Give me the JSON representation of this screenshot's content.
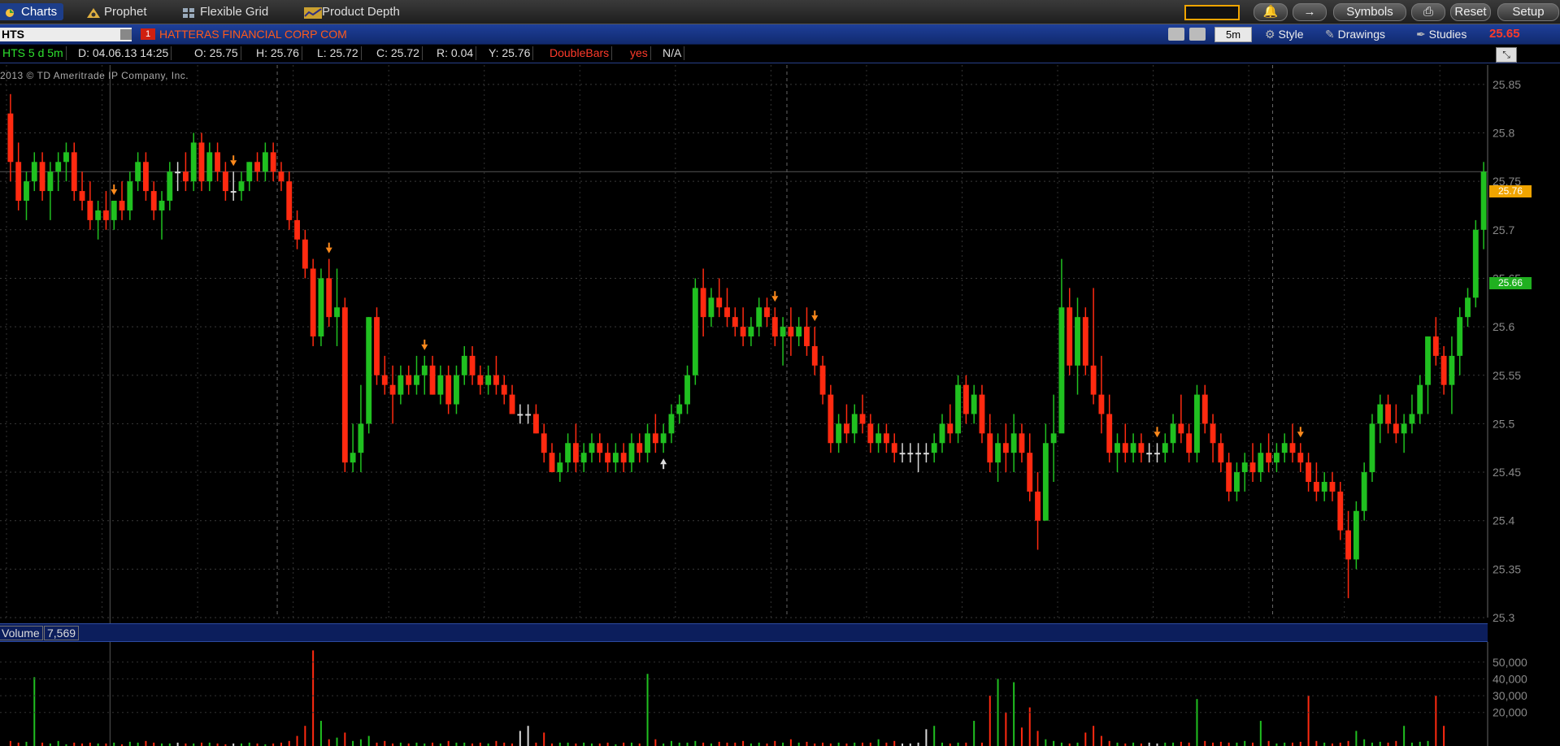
{
  "tabs": [
    {
      "label": "Charts",
      "active": true
    },
    {
      "label": "Prophet",
      "active": false
    },
    {
      "label": "Flexible Grid",
      "active": false
    },
    {
      "label": "Product Depth",
      "active": false
    }
  ],
  "right_buttons": {
    "symbols": "Symbols",
    "reset": "Reset",
    "setup": "Setup"
  },
  "symbol": "HTS",
  "company": "HATTERAS FINANCIAL CORP COM",
  "company_flag": "1",
  "toolbar": {
    "interval": "5m",
    "style": "Style",
    "drawings": "Drawings",
    "studies": "Studies",
    "last_price": "25.65"
  },
  "info": {
    "period": "HTS 5 d 5m",
    "date": "D: 04.06.13 14:25",
    "open": "O: 25.75",
    "high": "H: 25.76",
    "low": "L: 25.72",
    "close": "C: 25.72",
    "range": "R: 0.04",
    "y": "Y: 25.76",
    "doublebars": "DoubleBars",
    "yes": "yes",
    "na": "N/A"
  },
  "copyright": "2013 © TD Ameritrade IP Company, Inc.",
  "price_axis": {
    "ticks": [
      "25.85",
      "25.8",
      "25.75",
      "25.7",
      "25.65",
      "25.6",
      "25.55",
      "25.5",
      "25.45",
      "25.4",
      "25.35",
      "25.3"
    ],
    "cursor_label": "25.76",
    "last_label": "25.66"
  },
  "volume": {
    "label": "Volume",
    "value": "7,569",
    "ticks": [
      "50,000",
      "40,000",
      "30,000",
      "20,000"
    ]
  },
  "colors": {
    "up": "#20c020",
    "down": "#ff2a10",
    "neutral": "#d8d8d8",
    "arrow": "#ff8a1c",
    "tab_active": "#1d3e8a"
  },
  "icons": [
    "charts-icon",
    "prophet-icon",
    "grid-icon",
    "depth-icon",
    "bell-icon",
    "link-icon",
    "print-icon",
    "crosshair-icon",
    "wrench-icon",
    "style-icon",
    "pencil-icon",
    "studies-icon",
    "maximize-icon"
  ],
  "chart_data": {
    "type": "candlestick",
    "ylim": [
      25.3,
      25.87
    ],
    "candles": [
      [
        25.82,
        25.84,
        25.75,
        25.77
      ],
      [
        25.77,
        25.79,
        25.72,
        25.73
      ],
      [
        25.73,
        25.76,
        25.71,
        25.75
      ],
      [
        25.75,
        25.78,
        25.74,
        25.77
      ],
      [
        25.77,
        25.78,
        25.73,
        25.74
      ],
      [
        25.74,
        25.77,
        25.71,
        25.76
      ],
      [
        25.76,
        25.78,
        25.74,
        25.77
      ],
      [
        25.77,
        25.79,
        25.75,
        25.78
      ],
      [
        25.78,
        25.79,
        25.73,
        25.74
      ],
      [
        25.74,
        25.76,
        25.72,
        25.73
      ],
      [
        25.73,
        25.75,
        25.7,
        25.71
      ],
      [
        25.71,
        25.73,
        25.69,
        25.72
      ],
      [
        25.72,
        25.74,
        25.7,
        25.71
      ],
      [
        25.71,
        25.73,
        25.7,
        25.73
      ],
      [
        25.73,
        25.75,
        25.71,
        25.72
      ],
      [
        25.72,
        25.76,
        25.71,
        25.75
      ],
      [
        25.75,
        25.78,
        25.74,
        25.77
      ],
      [
        25.77,
        25.78,
        25.73,
        25.74
      ],
      [
        25.74,
        25.75,
        25.71,
        25.72
      ],
      [
        25.72,
        25.74,
        25.69,
        25.73
      ],
      [
        25.73,
        25.77,
        25.72,
        25.76
      ],
      [
        25.76,
        25.77,
        25.74,
        25.76
      ],
      [
        25.76,
        25.78,
        25.74,
        25.75
      ],
      [
        25.75,
        25.8,
        25.74,
        25.79
      ],
      [
        25.79,
        25.8,
        25.74,
        25.75
      ],
      [
        25.75,
        25.79,
        25.74,
        25.78
      ],
      [
        25.78,
        25.79,
        25.75,
        25.76
      ],
      [
        25.76,
        25.77,
        25.73,
        25.74
      ],
      [
        25.74,
        25.76,
        25.73,
        25.74
      ],
      [
        25.74,
        25.76,
        25.73,
        25.75
      ],
      [
        25.75,
        25.77,
        25.74,
        25.77
      ],
      [
        25.77,
        25.78,
        25.75,
        25.76
      ],
      [
        25.76,
        25.79,
        25.75,
        25.78
      ],
      [
        25.78,
        25.79,
        25.75,
        25.76
      ],
      [
        25.76,
        25.77,
        25.74,
        25.75
      ],
      [
        25.75,
        25.76,
        25.7,
        25.71
      ],
      [
        25.71,
        25.72,
        25.68,
        25.69
      ],
      [
        25.69,
        25.7,
        25.65,
        25.66
      ],
      [
        25.66,
        25.67,
        25.58,
        25.59
      ],
      [
        25.59,
        25.66,
        25.58,
        25.65
      ],
      [
        25.65,
        25.67,
        25.6,
        25.61
      ],
      [
        25.61,
        25.66,
        25.58,
        25.62
      ],
      [
        25.62,
        25.63,
        25.45,
        25.46
      ],
      [
        25.46,
        25.5,
        25.45,
        25.47
      ],
      [
        25.47,
        25.54,
        25.45,
        25.5
      ],
      [
        25.5,
        25.61,
        25.49,
        25.61
      ],
      [
        25.61,
        25.62,
        25.54,
        25.55
      ],
      [
        25.55,
        25.57,
        25.53,
        25.54
      ],
      [
        25.54,
        25.56,
        25.5,
        25.53
      ],
      [
        25.53,
        25.56,
        25.52,
        25.55
      ],
      [
        25.55,
        25.56,
        25.53,
        25.54
      ],
      [
        25.54,
        25.57,
        25.53,
        25.55
      ],
      [
        25.55,
        25.57,
        25.53,
        25.56
      ],
      [
        25.56,
        25.57,
        25.53,
        25.53
      ],
      [
        25.53,
        25.56,
        25.52,
        25.55
      ],
      [
        25.55,
        25.56,
        25.51,
        25.52
      ],
      [
        25.52,
        25.56,
        25.51,
        25.55
      ],
      [
        25.55,
        25.58,
        25.54,
        25.57
      ],
      [
        25.57,
        25.58,
        25.54,
        25.55
      ],
      [
        25.55,
        25.56,
        25.53,
        25.54
      ],
      [
        25.54,
        25.56,
        25.53,
        25.55
      ],
      [
        25.55,
        25.57,
        25.53,
        25.54
      ],
      [
        25.54,
        25.55,
        25.52,
        25.53
      ],
      [
        25.53,
        25.54,
        25.51,
        25.51
      ],
      [
        25.51,
        25.52,
        25.5,
        25.51
      ],
      [
        25.51,
        25.52,
        25.5,
        25.51
      ],
      [
        25.51,
        25.52,
        25.49,
        25.49
      ],
      [
        25.49,
        25.5,
        25.46,
        25.47
      ],
      [
        25.47,
        25.48,
        25.45,
        25.45
      ],
      [
        25.45,
        25.47,
        25.44,
        25.46
      ],
      [
        25.46,
        25.49,
        25.45,
        25.48
      ],
      [
        25.48,
        25.5,
        25.45,
        25.46
      ],
      [
        25.46,
        25.48,
        25.45,
        25.47
      ],
      [
        25.47,
        25.49,
        25.46,
        25.48
      ],
      [
        25.48,
        25.49,
        25.46,
        25.47
      ],
      [
        25.47,
        25.48,
        25.45,
        25.46
      ],
      [
        25.46,
        25.48,
        25.45,
        25.47
      ],
      [
        25.47,
        25.48,
        25.45,
        25.46
      ],
      [
        25.46,
        25.49,
        25.45,
        25.48
      ],
      [
        25.48,
        25.49,
        25.46,
        25.47
      ],
      [
        25.47,
        25.5,
        25.46,
        25.49
      ],
      [
        25.49,
        25.51,
        25.47,
        25.48
      ],
      [
        25.48,
        25.5,
        25.47,
        25.49
      ],
      [
        25.49,
        25.52,
        25.48,
        25.51
      ],
      [
        25.51,
        25.53,
        25.5,
        25.52
      ],
      [
        25.52,
        25.56,
        25.51,
        25.55
      ],
      [
        25.55,
        25.65,
        25.54,
        25.64
      ],
      [
        25.64,
        25.66,
        25.59,
        25.61
      ],
      [
        25.61,
        25.64,
        25.6,
        25.63
      ],
      [
        25.63,
        25.65,
        25.61,
        25.62
      ],
      [
        25.62,
        25.64,
        25.6,
        25.61
      ],
      [
        25.61,
        25.62,
        25.59,
        25.6
      ],
      [
        25.6,
        25.62,
        25.58,
        25.59
      ],
      [
        25.59,
        25.61,
        25.58,
        25.6
      ],
      [
        25.6,
        25.63,
        25.59,
        25.62
      ],
      [
        25.62,
        25.63,
        25.6,
        25.61
      ],
      [
        25.61,
        25.62,
        25.58,
        25.59
      ],
      [
        25.59,
        25.61,
        25.56,
        25.6
      ],
      [
        25.6,
        25.62,
        25.57,
        25.59
      ],
      [
        25.59,
        25.61,
        25.58,
        25.6
      ],
      [
        25.6,
        25.62,
        25.57,
        25.58
      ],
      [
        25.58,
        25.6,
        25.55,
        25.56
      ],
      [
        25.56,
        25.57,
        25.52,
        25.53
      ],
      [
        25.53,
        25.54,
        25.47,
        25.48
      ],
      [
        25.48,
        25.51,
        25.47,
        25.5
      ],
      [
        25.5,
        25.52,
        25.48,
        25.49
      ],
      [
        25.49,
        25.52,
        25.48,
        25.51
      ],
      [
        25.51,
        25.53,
        25.49,
        25.5
      ],
      [
        25.5,
        25.51,
        25.47,
        25.48
      ],
      [
        25.48,
        25.5,
        25.47,
        25.49
      ],
      [
        25.49,
        25.5,
        25.47,
        25.48
      ],
      [
        25.48,
        25.49,
        25.46,
        25.47
      ],
      [
        25.47,
        25.48,
        25.46,
        25.47
      ],
      [
        25.47,
        25.48,
        25.46,
        25.47
      ],
      [
        25.47,
        25.48,
        25.45,
        25.47
      ],
      [
        25.47,
        25.48,
        25.46,
        25.47
      ],
      [
        25.47,
        25.49,
        25.46,
        25.48
      ],
      [
        25.48,
        25.51,
        25.47,
        25.5
      ],
      [
        25.5,
        25.52,
        25.48,
        25.49
      ],
      [
        25.49,
        25.55,
        25.48,
        25.54
      ],
      [
        25.54,
        25.55,
        25.5,
        25.51
      ],
      [
        25.51,
        25.54,
        25.5,
        25.53
      ],
      [
        25.53,
        25.54,
        25.48,
        25.49
      ],
      [
        25.49,
        25.51,
        25.45,
        25.46
      ],
      [
        25.46,
        25.49,
        25.44,
        25.48
      ],
      [
        25.48,
        25.5,
        25.45,
        25.47
      ],
      [
        25.47,
        25.51,
        25.45,
        25.49
      ],
      [
        25.49,
        25.5,
        25.46,
        25.47
      ],
      [
        25.47,
        25.49,
        25.42,
        25.43
      ],
      [
        25.43,
        25.45,
        25.37,
        25.4
      ],
      [
        25.4,
        25.5,
        25.42,
        25.48
      ],
      [
        25.48,
        25.53,
        25.44,
        25.49
      ],
      [
        25.49,
        25.67,
        25.5,
        25.62
      ],
      [
        25.62,
        25.64,
        25.55,
        25.56
      ],
      [
        25.56,
        25.63,
        25.53,
        25.61
      ],
      [
        25.61,
        25.62,
        25.55,
        25.56
      ],
      [
        25.56,
        25.64,
        25.52,
        25.53
      ],
      [
        25.53,
        25.57,
        25.49,
        25.51
      ],
      [
        25.51,
        25.53,
        25.46,
        25.47
      ],
      [
        25.47,
        25.49,
        25.45,
        25.48
      ],
      [
        25.48,
        25.5,
        25.46,
        25.47
      ],
      [
        25.47,
        25.49,
        25.46,
        25.48
      ],
      [
        25.48,
        25.49,
        25.46,
        25.47
      ],
      [
        25.47,
        25.48,
        25.46,
        25.47
      ],
      [
        25.47,
        25.48,
        25.46,
        25.47
      ],
      [
        25.47,
        25.49,
        25.46,
        25.48
      ],
      [
        25.48,
        25.51,
        25.47,
        25.5
      ],
      [
        25.5,
        25.53,
        25.48,
        25.49
      ],
      [
        25.49,
        25.5,
        25.46,
        25.47
      ],
      [
        25.47,
        25.54,
        25.46,
        25.53
      ],
      [
        25.53,
        25.54,
        25.49,
        25.5
      ],
      [
        25.5,
        25.51,
        25.46,
        25.48
      ],
      [
        25.48,
        25.49,
        25.45,
        25.46
      ],
      [
        25.46,
        25.47,
        25.42,
        25.43
      ],
      [
        25.43,
        25.46,
        25.42,
        25.45
      ],
      [
        25.45,
        25.47,
        25.43,
        25.46
      ],
      [
        25.46,
        25.48,
        25.44,
        25.45
      ],
      [
        25.45,
        25.48,
        25.44,
        25.47
      ],
      [
        25.47,
        25.49,
        25.45,
        25.46
      ],
      [
        25.46,
        25.48,
        25.45,
        25.47
      ],
      [
        25.47,
        25.49,
        25.46,
        25.48
      ],
      [
        25.48,
        25.5,
        25.46,
        25.47
      ],
      [
        25.47,
        25.48,
        25.45,
        25.46
      ],
      [
        25.46,
        25.47,
        25.43,
        25.44
      ],
      [
        25.44,
        25.46,
        25.42,
        25.43
      ],
      [
        25.43,
        25.45,
        25.42,
        25.44
      ],
      [
        25.44,
        25.45,
        25.42,
        25.43
      ],
      [
        25.43,
        25.44,
        25.38,
        25.39
      ],
      [
        25.39,
        25.41,
        25.32,
        25.36
      ],
      [
        25.36,
        25.42,
        25.35,
        25.41
      ],
      [
        25.41,
        25.46,
        25.4,
        25.45
      ],
      [
        25.45,
        25.51,
        25.44,
        25.5
      ],
      [
        25.5,
        25.53,
        25.48,
        25.52
      ],
      [
        25.52,
        25.53,
        25.49,
        25.5
      ],
      [
        25.5,
        25.52,
        25.48,
        25.49
      ],
      [
        25.49,
        25.51,
        25.47,
        25.5
      ],
      [
        25.5,
        25.53,
        25.49,
        25.51
      ],
      [
        25.51,
        25.55,
        25.5,
        25.54
      ],
      [
        25.54,
        25.59,
        25.51,
        25.59
      ],
      [
        25.59,
        25.61,
        25.56,
        25.57
      ],
      [
        25.57,
        25.58,
        25.53,
        25.54
      ],
      [
        25.54,
        25.59,
        25.51,
        25.57
      ],
      [
        25.57,
        25.62,
        25.55,
        25.61
      ],
      [
        25.61,
        25.64,
        25.6,
        25.63
      ],
      [
        25.63,
        25.71,
        25.62,
        25.7
      ],
      [
        25.7,
        25.77,
        25.68,
        25.76
      ]
    ],
    "volume": [
      3000,
      2000,
      2500,
      41000,
      2000,
      1500,
      3000,
      1000,
      2000,
      1500,
      2000,
      1500,
      1500,
      2000,
      1000,
      2500,
      2000,
      3000,
      2000,
      1500,
      1500,
      2000,
      1500,
      1500,
      2000,
      2000,
      1500,
      1000,
      1500,
      1500,
      2000,
      1500,
      1000,
      1500,
      2000,
      3000,
      6000,
      12000,
      57000,
      15000,
      4000,
      5000,
      8000,
      3000,
      4000,
      6000,
      2000,
      3000,
      1500,
      2000,
      1500,
      2000,
      1500,
      2000,
      1500,
      3000,
      2000,
      2000,
      1500,
      2000,
      1500,
      3000,
      2000,
      1500,
      9000,
      12000,
      2000,
      8000,
      1500,
      2000,
      2000,
      1500,
      2000,
      1500,
      1500,
      2000,
      1000,
      2000,
      2000,
      1500,
      43000,
      4000,
      1500,
      3000,
      2000,
      2000,
      3000,
      2000,
      1500,
      2500,
      2000,
      2000,
      3000,
      1500,
      2000,
      1500,
      3000,
      2000,
      4000,
      2000,
      2500,
      1500,
      2000,
      1500,
      2000,
      1500,
      2000,
      2000,
      2000,
      4000,
      2000,
      3000,
      1500,
      1500,
      2000,
      10000,
      12000,
      2000,
      1500,
      2000,
      2000,
      15000,
      2000,
      30000,
      40000,
      20000,
      38000,
      11000,
      23000,
      9000,
      4000,
      3000,
      2000,
      1500,
      2000,
      8000,
      12000,
      6000,
      3000,
      2000,
      1500,
      2000,
      1500,
      2000,
      1500,
      2000,
      2000,
      2500,
      2000,
      28000,
      3000,
      2000,
      2500,
      2000,
      2000,
      3000,
      2000,
      15000,
      3000,
      1500,
      2000,
      2000,
      2500,
      30000,
      3000,
      2000,
      1500,
      2000,
      3000,
      9000,
      4000,
      2000,
      2500,
      2000,
      3000,
      12000,
      2000,
      2500,
      3000,
      30000,
      12000
    ]
  }
}
